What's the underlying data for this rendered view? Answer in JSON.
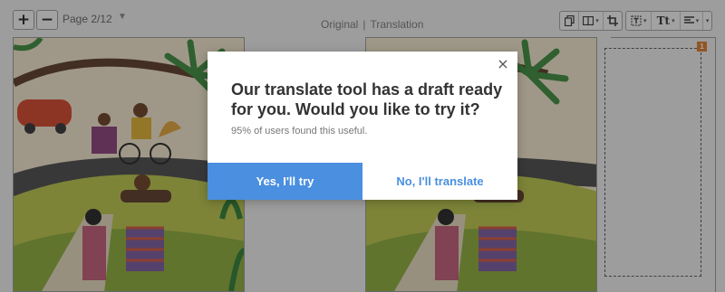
{
  "toolbar": {
    "zoom_in": {
      "label": "+",
      "icon": "plus-icon"
    },
    "zoom_out": {
      "label": "−",
      "icon": "minus-icon"
    },
    "page_indicator": "Page 2/12",
    "view_tabs": {
      "original": "Original",
      "separator": "|",
      "translation": "Translation"
    },
    "format_caret": "▾",
    "tools": {
      "group1": [
        "copy-icon",
        "layout-icon",
        "crop-icon"
      ],
      "group2": [
        "text-box-icon",
        "font-size-icon",
        "align-icon"
      ],
      "font_size_glyph": "Tt"
    }
  },
  "panes": {
    "textbox_badge": "1"
  },
  "modal": {
    "close_glyph": "×",
    "title": "Our translate tool has a draft ready for you. Would you like to try it?",
    "subtitle": "95% of users found this useful.",
    "accept_label": "Yes, I'll try",
    "decline_label": "No, I'll translate"
  },
  "colors": {
    "accent": "#4a8fe0",
    "badge": "#e07a25",
    "overlay": "rgba(30,30,30,0.40)"
  }
}
